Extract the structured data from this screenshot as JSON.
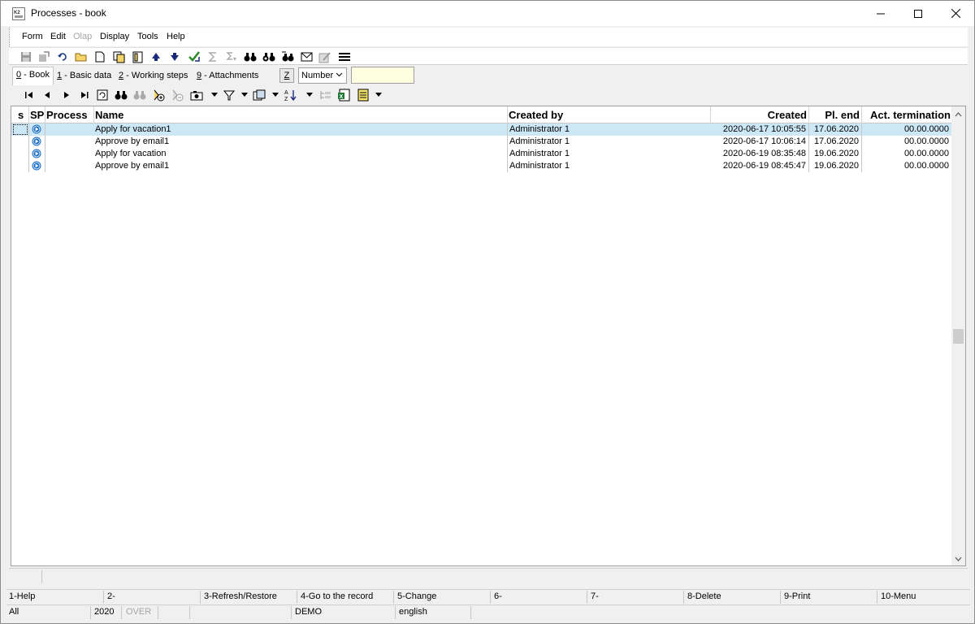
{
  "window": {
    "title": "Processes - book",
    "app_icon": "k2-app-icon"
  },
  "menu": {
    "items": [
      "Form",
      "Edit",
      "Olap",
      "Display",
      "Tools",
      "Help"
    ]
  },
  "toolbar": {
    "icons": [
      "save-icon",
      "export-icon",
      "undo-icon",
      "open-icon",
      "new-document-icon",
      "copy-document-icon",
      "book-icon",
      "arrow-up-icon",
      "arrow-down-icon",
      "confirm-icon",
      "sum-icon",
      "sum-filter-icon",
      "binoculars-icon",
      "binoculars-next-icon",
      "binoculars-replace-icon",
      "envelope-icon",
      "notes-icon",
      "menu-lines-icon"
    ]
  },
  "tabs": [
    {
      "key": "0",
      "label": " - Book",
      "active": true
    },
    {
      "key": "1",
      "label": " - Basic data",
      "active": false
    },
    {
      "key": "2",
      "label": " - Working steps",
      "active": false
    },
    {
      "key": "9",
      "label": " - Attachments",
      "active": false
    }
  ],
  "search": {
    "z_label": "Z",
    "field_label": "Number",
    "value": ""
  },
  "table": {
    "headers": {
      "s": "s",
      "sp": "SP",
      "process": "Process",
      "name": "Name",
      "created_by": "Created by",
      "created": "Created",
      "pl_end": "Pl. end",
      "act_termination": "Act. termination"
    },
    "rows": [
      {
        "name": "Apply for vacation1",
        "created_by": "Administrator 1",
        "created": "2020-06-17 10:05:55",
        "pl_end": "17.06.2020",
        "act_termination": "00.00.0000",
        "selected": true
      },
      {
        "name": "Approve by email1",
        "created_by": "Administrator 1",
        "created": "2020-06-17 10:06:14",
        "pl_end": "17.06.2020",
        "act_termination": "00.00.0000",
        "selected": false
      },
      {
        "name": "Apply for vacation",
        "created_by": "Administrator 1",
        "created": "2020-06-19 08:35:48",
        "pl_end": "19.06.2020",
        "act_termination": "00.00.0000",
        "selected": false
      },
      {
        "name": "Approve by email1",
        "created_by": "Administrator 1",
        "created": "2020-06-19 08:45:47",
        "pl_end": "19.06.2020",
        "act_termination": "00.00.0000",
        "selected": false
      }
    ]
  },
  "fkeys": [
    "1-Help",
    "2-",
    "3-Refresh/Restore",
    "4-Go to the record",
    "5-Change",
    "6-",
    "7-",
    "8-Delete",
    "9-Print",
    "10-Menu"
  ],
  "statusbar": {
    "filter": "All",
    "year": "2020",
    "mode": "OVER",
    "database": "DEMO",
    "language": "english"
  },
  "colors": {
    "selection": "#cce8f7",
    "sp_icon": "#1e6fc8",
    "search_bg": "#fefee0"
  }
}
